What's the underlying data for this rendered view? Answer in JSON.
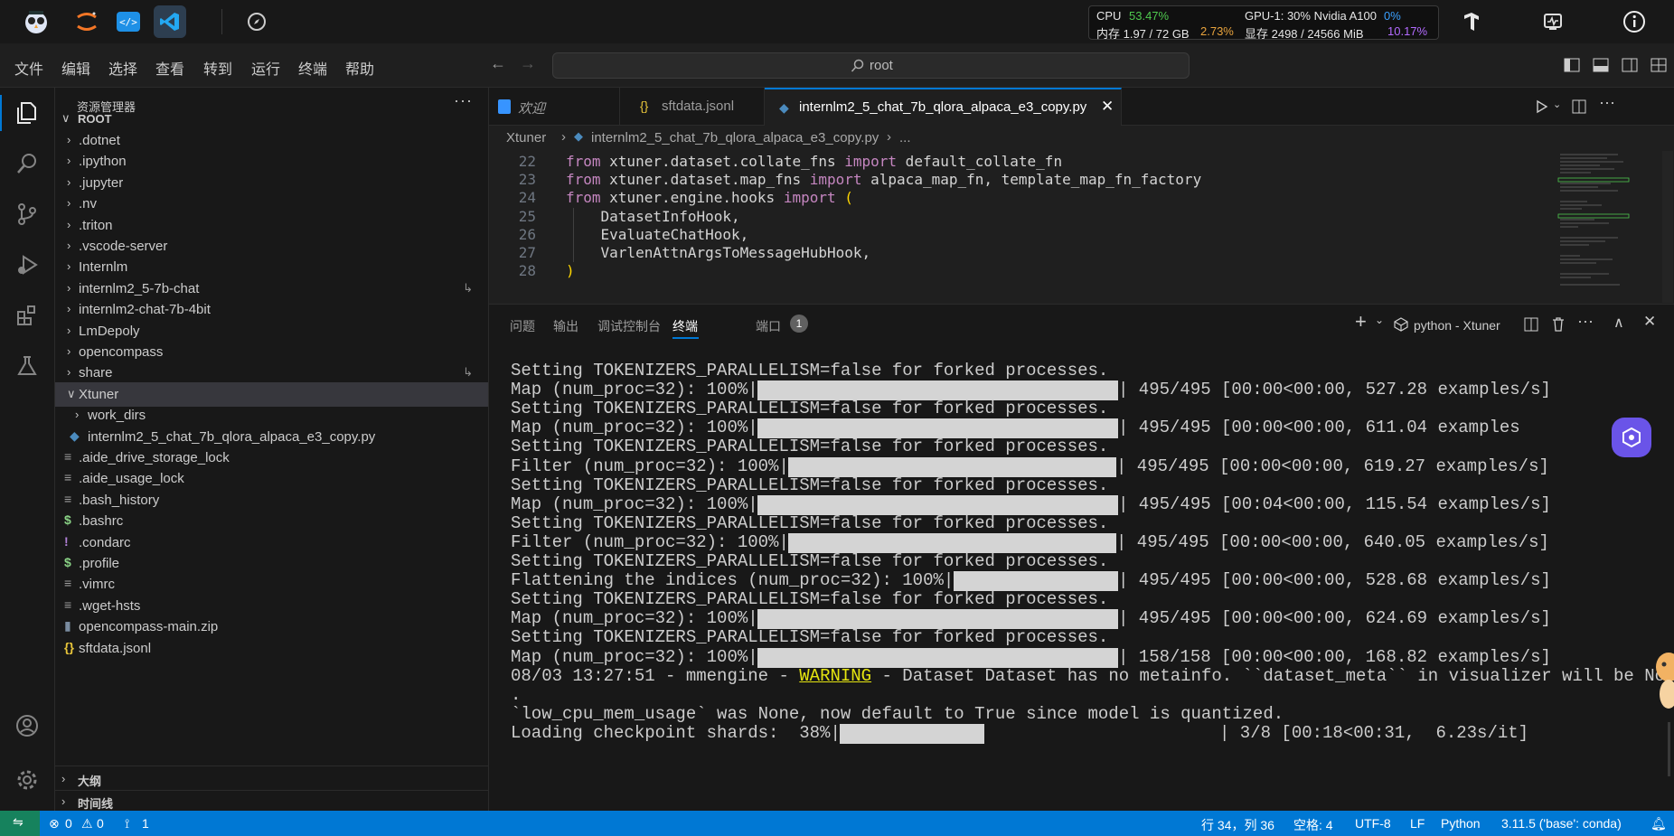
{
  "system_bar": {
    "cpu_label": "CPU",
    "cpu_value": "53.47%",
    "mem_label": "内存 1.97 / 72 GB",
    "mem_value": "2.73%",
    "gpu_label": "GPU-1: 30% Nvidia A100",
    "gpu_value": "0%",
    "vram_label": "显存 2498 / 24566 MiB",
    "vram_value": "10.17%"
  },
  "menu": [
    "文件",
    "编辑",
    "选择",
    "查看",
    "转到",
    "运行",
    "终端",
    "帮助"
  ],
  "command_center": {
    "text": "root"
  },
  "explorer": {
    "title": "资源管理器",
    "root": "ROOT",
    "items": [
      {
        "label": ".dotnet",
        "kind": "folder"
      },
      {
        "label": ".ipython",
        "kind": "folder"
      },
      {
        "label": ".jupyter",
        "kind": "folder"
      },
      {
        "label": ".nv",
        "kind": "folder"
      },
      {
        "label": ".triton",
        "kind": "folder"
      },
      {
        "label": ".vscode-server",
        "kind": "folder"
      },
      {
        "label": "Internlm",
        "kind": "folder"
      },
      {
        "label": "internlm2_5-7b-chat",
        "kind": "folder"
      },
      {
        "label": "internlm2-chat-7b-4bit",
        "kind": "folder"
      },
      {
        "label": "LmDepoly",
        "kind": "folder"
      },
      {
        "label": "opencompass",
        "kind": "folder"
      },
      {
        "label": "share",
        "kind": "folder"
      },
      {
        "label": "Xtuner",
        "kind": "folder-open"
      },
      {
        "label": "work_dirs",
        "kind": "subfolder"
      },
      {
        "label": "internlm2_5_chat_7b_qlora_alpaca_e3_copy.py",
        "kind": "subfile-py"
      },
      {
        "label": ".aide_drive_storage_lock",
        "kind": "file"
      },
      {
        "label": ".aide_usage_lock",
        "kind": "file"
      },
      {
        "label": ".bash_history",
        "kind": "file"
      },
      {
        "label": ".bashrc",
        "kind": "file-sh"
      },
      {
        "label": ".condarc",
        "kind": "file-bang"
      },
      {
        "label": ".profile",
        "kind": "file-sh"
      },
      {
        "label": ".vimrc",
        "kind": "file"
      },
      {
        "label": ".wget-hsts",
        "kind": "file"
      },
      {
        "label": "opencompass-main.zip",
        "kind": "file-zip"
      },
      {
        "label": "sftdata.jsonl",
        "kind": "file-json"
      }
    ],
    "outline": "大纲",
    "timeline": "时间线"
  },
  "tabs": [
    {
      "label": "欢迎"
    },
    {
      "label": "sftdata.jsonl",
      "icon": "{}"
    },
    {
      "label": "internlm2_5_chat_7b_qlora_alpaca_e3_copy.py"
    }
  ],
  "breadcrumb": {
    "folder": "Xtuner",
    "file": "internlm2_5_chat_7b_qlora_alpaca_e3_copy.py",
    "more": "..."
  },
  "code": [
    {
      "n": "22",
      "pre": "from",
      "rest": " xtuner.dataset.collate_fns ",
      "kw2": "import",
      "tail": " default_collate_fn"
    },
    {
      "n": "23",
      "pre": "from",
      "rest": " xtuner.dataset.map_fns ",
      "kw2": "import",
      "tail": " alpaca_map_fn, template_map_fn_factory"
    },
    {
      "n": "24",
      "pre": "from",
      "rest": " xtuner.engine.hooks ",
      "kw2": "import",
      "tail": " ("
    },
    {
      "n": "25",
      "pre": "",
      "rest": "    DatasetInfoHook,",
      "kw2": "",
      "tail": ""
    },
    {
      "n": "26",
      "pre": "",
      "rest": "    EvaluateChatHook,",
      "kw2": "",
      "tail": ""
    },
    {
      "n": "27",
      "pre": "",
      "rest": "    VarlenAttnArgsToMessageHubHook,",
      "kw2": "",
      "tail": ""
    },
    {
      "n": "28",
      "pre": "",
      "rest": ")",
      "kw2": "",
      "tail": ""
    }
  ],
  "panel": {
    "tabs": [
      "问题",
      "输出",
      "调试控制台",
      "终端",
      "端口"
    ],
    "ports_badge": "1",
    "terminal_name": "python - Xtuner"
  },
  "terminal": [
    {
      "text": "Setting TOKENIZERS_PARALLELISM=false for forked processes."
    },
    {
      "prefix": "Map (num_proc=32): 100%|",
      "progress": 1.0,
      "suffix": "| 495/495 [00:00<00:00, 527.28 examples/s]"
    },
    {
      "text": "Setting TOKENIZERS_PARALLELISM=false for forked processes."
    },
    {
      "prefix": "Map (num_proc=32): 100%|",
      "progress": 1.0,
      "suffix": "| 495/495 [00:00<00:00, 611.04 examples"
    },
    {
      "text": "Setting TOKENIZERS_PARALLELISM=false for forked processes."
    },
    {
      "prefix": "Filter (num_proc=32): 100%|",
      "progress": 1.0,
      "suffix": "| 495/495 [00:00<00:00, 619.27 examples/s]"
    },
    {
      "text": "Setting TOKENIZERS_PARALLELISM=false for forked processes."
    },
    {
      "prefix": "Map (num_proc=32): 100%|",
      "progress": 1.0,
      "suffix": "| 495/495 [00:04<00:00, 115.54 examples/s]"
    },
    {
      "text": "Setting TOKENIZERS_PARALLELISM=false for forked processes."
    },
    {
      "prefix": "Filter (num_proc=32): 100%|",
      "progress": 1.0,
      "suffix": "| 495/495 [00:00<00:00, 640.05 examples/s]"
    },
    {
      "text": "Setting TOKENIZERS_PARALLELISM=false for forked processes."
    },
    {
      "prefix": "Flattening the indices (num_proc=32): 100%|",
      "progress": 1.0,
      "suffix": "| 495/495 [00:00<00:00, 528.68 examples/s]"
    },
    {
      "text": "Setting TOKENIZERS_PARALLELISM=false for forked processes."
    },
    {
      "prefix": "Map (num_proc=32): 100%|",
      "progress": 1.0,
      "suffix": "| 495/495 [00:00<00:00, 624.69 examples/s]"
    },
    {
      "text": "Setting TOKENIZERS_PARALLELISM=false for forked processes."
    },
    {
      "prefix": "Map (num_proc=32): 100%|",
      "progress": 1.0,
      "suffix": "| 158/158 [00:00<00:00, 168.82 examples/s]"
    },
    {
      "warn_pre": "08/03 13:27:51 - mmengine - ",
      "warn": "WARNING",
      "warn_post": " - Dataset Dataset has no metainfo. ``dataset_meta`` in visualizer will be None"
    },
    {
      "text": "."
    },
    {
      "text": "`low_cpu_mem_usage` was None, now default to True since model is quantized."
    },
    {
      "prefix": "Loading checkpoint shards:  38%|",
      "progress": 0.38,
      "suffix": "| 3/8 [00:18<00:31,  6.23s/it]"
    }
  ],
  "status_bar": {
    "errors": "0",
    "warnings": "0",
    "ports": "1",
    "position": "行 34，列 36",
    "spaces": "空格: 4",
    "encoding": "UTF-8",
    "eol": "LF",
    "language": "Python",
    "interpreter": "3.11.5 ('base': conda)"
  },
  "colors": {
    "accent": "#0078d4",
    "cpu": "#4ec94e",
    "mem": "#e8a33d",
    "gpu": "#3aa0ff",
    "vram": "#b36bff",
    "warning": "#e5e510"
  }
}
